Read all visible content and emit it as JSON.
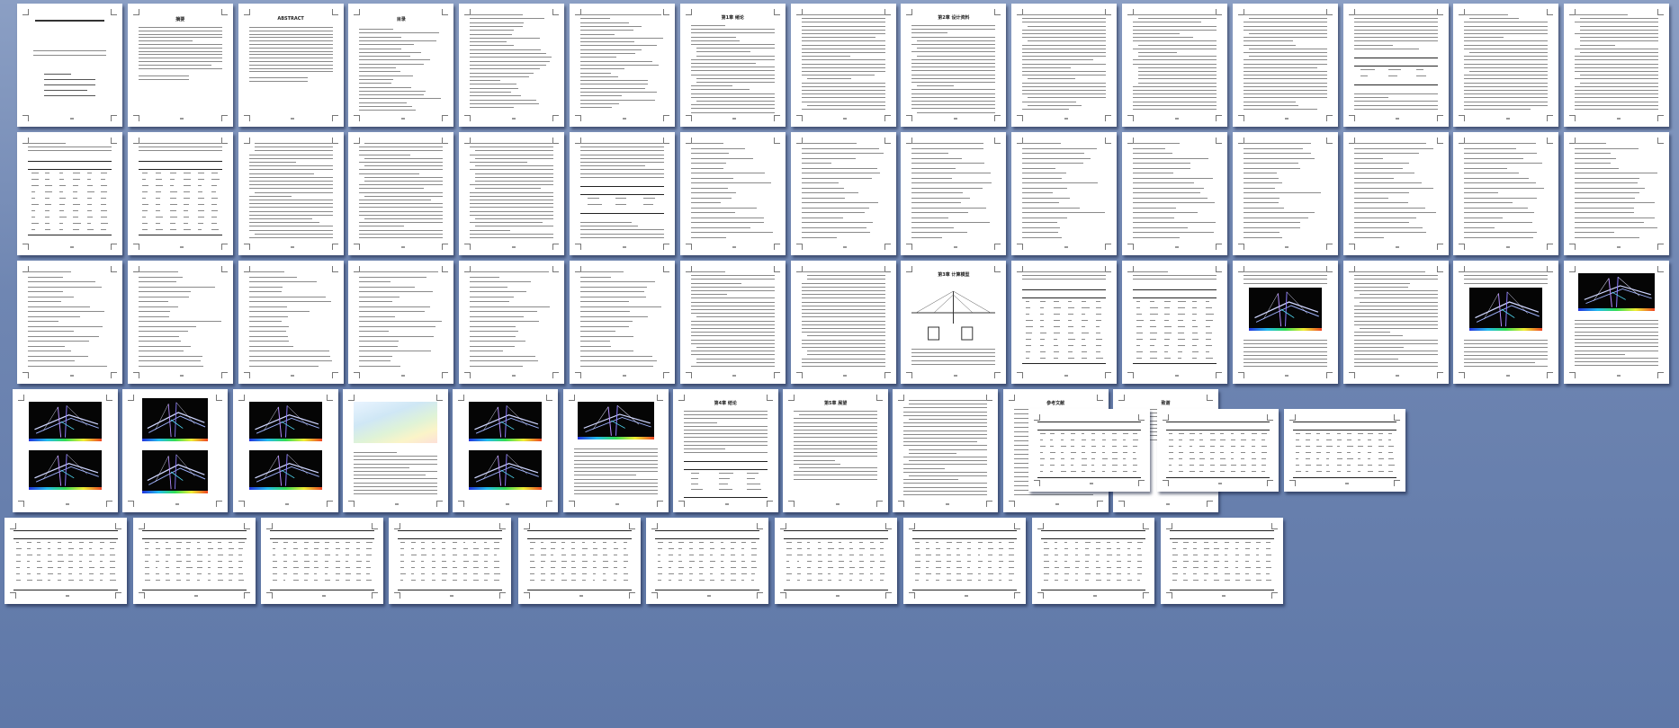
{
  "window": {
    "title": ""
  },
  "view": {
    "mode": "print-preview-multipage",
    "background": "#6f86b2"
  },
  "document": {
    "rows": [
      {
        "row": 1,
        "pages": 15
      },
      {
        "row": 2,
        "pages": 15
      },
      {
        "row": 3,
        "pages": 15
      },
      {
        "row": 4,
        "pages": 14
      },
      {
        "row": 5,
        "pages": 10
      }
    ],
    "headings": {
      "ch1": "第1章 绪论",
      "ch2": "第2章 设计资料",
      "ch3": "第3章 计算模型",
      "ch4": "第4章 结论",
      "ch5": "第5章 展望",
      "refs": "参考文献",
      "thanks": "致谢",
      "abstract": "摘要",
      "abstract_en": "ABSTRACT",
      "toc": "目录"
    }
  },
  "icons": {
    "page": "page-thumbnail-icon",
    "screenshot": "fem-screenshot-icon"
  }
}
